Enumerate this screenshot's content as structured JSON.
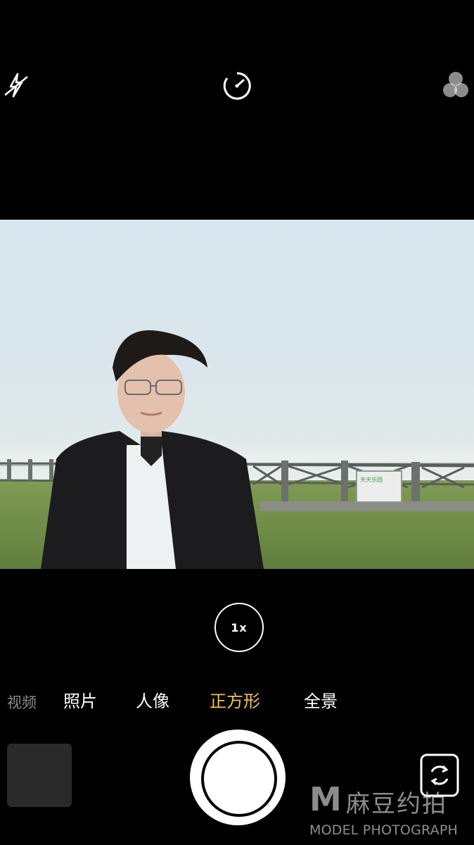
{
  "toolbar": {
    "flash_icon": "flash-off-icon",
    "timer_icon": "timer-icon",
    "filters_icon": "filters-icon"
  },
  "zoom": {
    "label": "1x"
  },
  "modes": [
    {
      "label": "视频",
      "state": "dim"
    },
    {
      "label": "照片",
      "state": "normal"
    },
    {
      "label": "人像",
      "state": "normal"
    },
    {
      "label": "正方形",
      "state": "active"
    },
    {
      "label": "全景",
      "state": "normal"
    }
  ],
  "viewfinder": {
    "sign_text": "天天乐园"
  },
  "watermark": {
    "mark": "M",
    "cn": "麻豆约拍",
    "en": "MODEL PHOTOGRAPH"
  },
  "colors": {
    "active_mode": "#f0c15b",
    "background": "#000000"
  }
}
